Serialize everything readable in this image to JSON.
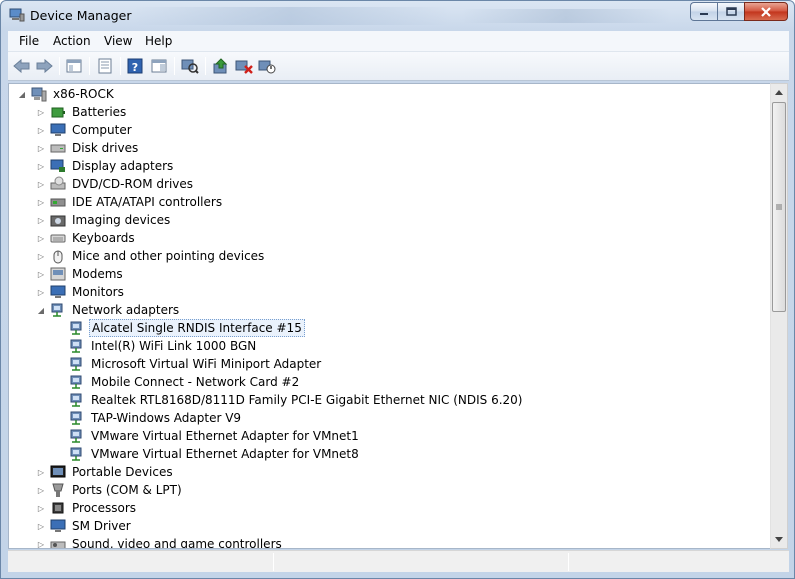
{
  "window": {
    "title": "Device Manager",
    "min_label": "minimize",
    "max_label": "maximize",
    "close_label": "close"
  },
  "menu": [
    "File",
    "Action",
    "View",
    "Help"
  ],
  "toolbar": [
    {
      "name": "back-icon"
    },
    {
      "name": "forward-icon"
    },
    {
      "name": "show-hide-tree-icon"
    },
    {
      "name": "properties-icon"
    },
    {
      "name": "help-icon"
    },
    {
      "name": "show-action-pane-icon"
    },
    {
      "name": "scan-hardware-icon"
    },
    {
      "name": "update-driver-icon"
    },
    {
      "name": "uninstall-icon"
    },
    {
      "name": "disable-device-icon"
    }
  ],
  "tree": {
    "root": "x86-ROCK",
    "categories_before": [
      {
        "label": "Batteries",
        "icon": "battery-icon"
      },
      {
        "label": "Computer",
        "icon": "computer-icon"
      },
      {
        "label": "Disk drives",
        "icon": "disk-drive-icon"
      },
      {
        "label": "Display adapters",
        "icon": "display-adapter-icon"
      },
      {
        "label": "DVD/CD-ROM drives",
        "icon": "dvd-drive-icon"
      },
      {
        "label": "IDE ATA/ATAPI controllers",
        "icon": "ide-controller-icon"
      },
      {
        "label": "Imaging devices",
        "icon": "camera-icon"
      },
      {
        "label": "Keyboards",
        "icon": "keyboard-icon"
      },
      {
        "label": "Mice and other pointing devices",
        "icon": "mouse-icon"
      },
      {
        "label": "Modems",
        "icon": "modem-icon"
      },
      {
        "label": "Monitors",
        "icon": "monitor-icon"
      }
    ],
    "network": {
      "label": "Network adapters",
      "children": [
        "Alcatel Single RNDIS Interface #15",
        "Intel(R) WiFi Link 1000 BGN",
        "Microsoft Virtual WiFi Miniport Adapter",
        "Mobile Connect - Network Card #2",
        "Realtek RTL8168D/8111D Family PCI-E Gigabit Ethernet NIC (NDIS 6.20)",
        "TAP-Windows Adapter V9",
        "VMware Virtual Ethernet Adapter for VMnet1",
        "VMware Virtual Ethernet Adapter for VMnet8"
      ],
      "selected_index": 0
    },
    "categories_after": [
      {
        "label": "Portable Devices",
        "icon": "portable-device-icon"
      },
      {
        "label": "Ports (COM & LPT)",
        "icon": "port-icon"
      },
      {
        "label": "Processors",
        "icon": "processor-icon"
      },
      {
        "label": "SM Driver",
        "icon": "sm-driver-icon"
      },
      {
        "label": "Sound, video and game controllers",
        "icon": "sound-icon"
      }
    ]
  },
  "colors": {
    "selection_border": "#7aa0d0",
    "window_frame": "#c3d4e8",
    "close_button": "#c2341c"
  }
}
